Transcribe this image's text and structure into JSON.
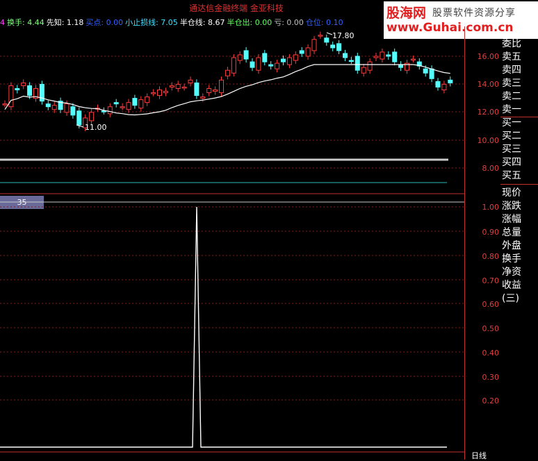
{
  "window": {
    "title": "通达信金融终端    金亚科技"
  },
  "logo": {
    "cn": "股海网",
    "sub": "股票软件资源分享",
    "url": "www.Guhai.com.cn"
  },
  "indicators": [
    {
      "text": "4",
      "color": "#ff40ff"
    },
    {
      "text": "换手: 4.44",
      "color": "#80ff80"
    },
    {
      "text": "先知: 1.18",
      "color": "#ffffff"
    },
    {
      "text": "买点: 0.00",
      "color": "#3060ff"
    },
    {
      "text": "小止损线: 7.05",
      "color": "#40e0ff"
    },
    {
      "text": "半仓线: 8.67",
      "color": "#ffffff"
    },
    {
      "text": "半仓出: 0.00",
      "color": "#60ff60"
    },
    {
      "text": "亏: 0.00",
      "color": "#c0c0c0"
    },
    {
      "text": "仓位: 0.10",
      "color": "#3060ff"
    }
  ],
  "main_chart": {
    "high_label": "17.80",
    "low_label": "11.00",
    "y_labels": [
      "16.00",
      "14.00",
      "12.00",
      "10.00",
      "8.00"
    ]
  },
  "sub_chart": {
    "period_tag": "35",
    "y_labels": [
      "1.00",
      "0.90",
      "0.80",
      "0.70",
      "0.60",
      "0.50",
      "0.40",
      "0.30",
      "0.20"
    ]
  },
  "side_panel": {
    "items": [
      "委比",
      "卖五",
      "卖四",
      "卖三",
      "卖二",
      "卖一",
      "买一",
      "买二",
      "买三",
      "买四",
      "买五",
      "现价",
      "涨跌",
      "涨幅",
      "总量",
      "外盘",
      "换手",
      "净资",
      "收益(三)"
    ]
  },
  "bottom": {
    "label": "日线"
  },
  "colors": {
    "up": "#ff3c3c",
    "down": "#54ffff",
    "ma": "#ffffff",
    "grid": "#8a1a1a"
  }
}
